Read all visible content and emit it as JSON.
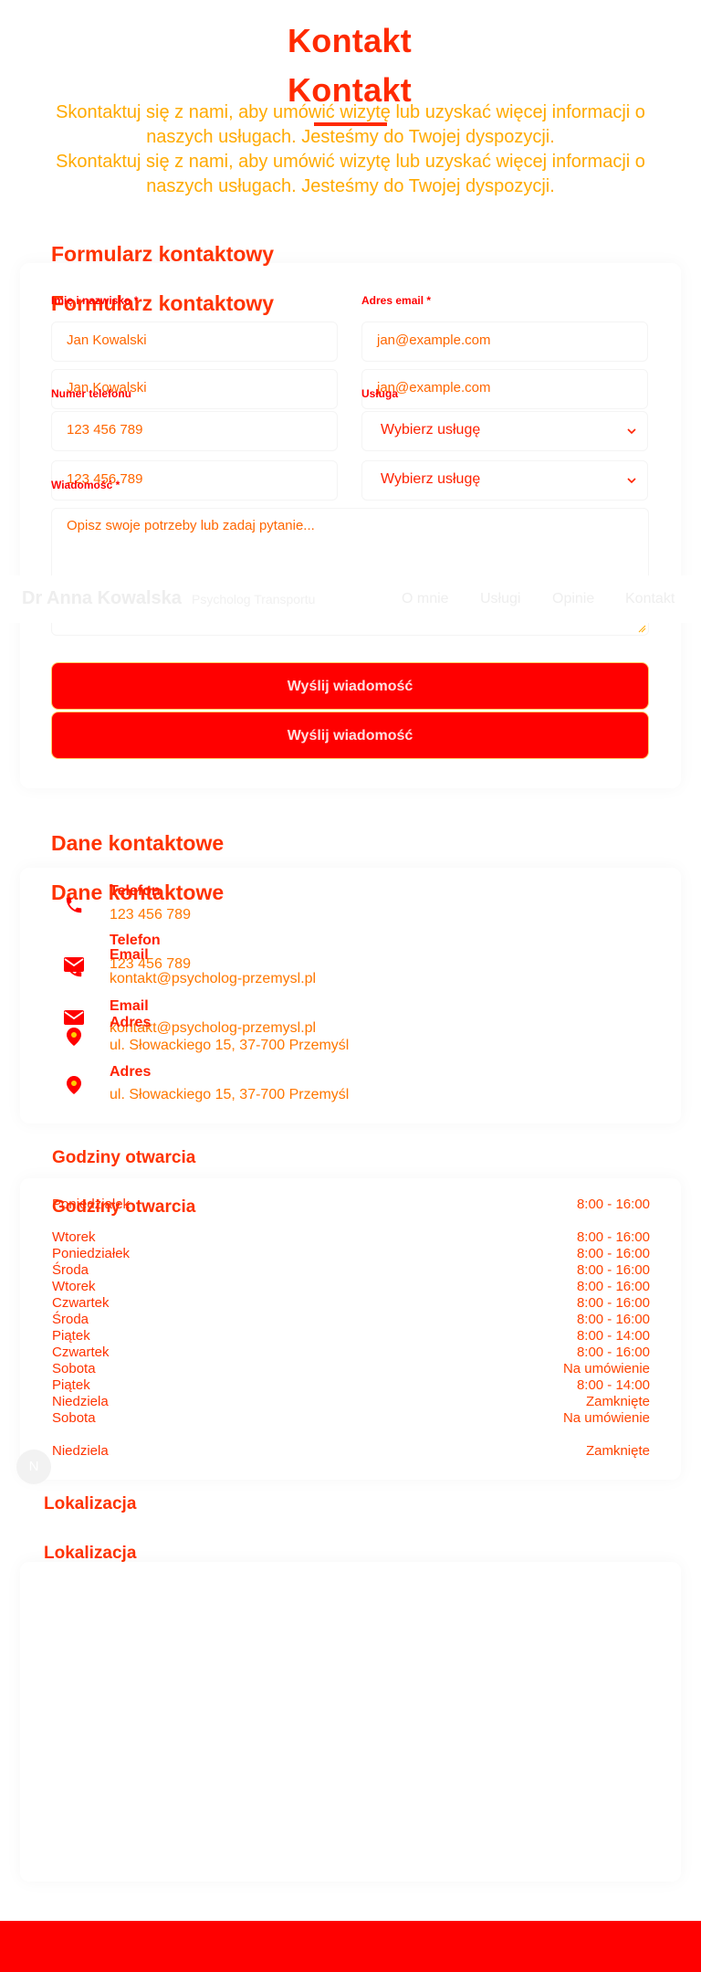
{
  "page": {
    "title": "Kontakt",
    "subtitle": "Skontaktuj się z nami, aby umówić wizytę lub uzyskać więcej informacji o naszych usługach. Jesteśmy do Twojej dyspozycji."
  },
  "navbar": {
    "brand": "Dr Anna Kowalska",
    "tagline": "Psycholog Transportu",
    "links": [
      "O mnie",
      "Usługi",
      "Opinie",
      "Kontakt"
    ]
  },
  "form": {
    "title": "Formularz kontaktowy",
    "name_label": "Imię i nazwisko *",
    "name_placeholder": "Jan Kowalski",
    "email_label": "Adres email *",
    "email_placeholder": "jan@example.com",
    "phone_label": "Numer telefonu",
    "phone_placeholder": "123 456 789",
    "service_label": "Usługa",
    "service_selected": "Wybierz usługę",
    "message_label": "Wiadomość *",
    "message_placeholder": "Opisz swoje potrzeby lub zadaj pytanie...",
    "submit_label": "Wyślij wiadomość"
  },
  "contact": {
    "title": "Dane kontaktowe",
    "items": [
      {
        "icon": "phone-icon",
        "label": "Telefon",
        "value": "123 456 789"
      },
      {
        "icon": "envelope-icon",
        "label": "Email",
        "value": "kontakt@psycholog-przemysl.pl"
      },
      {
        "icon": "map-pin-icon",
        "label": "Adres",
        "value": "ul. Słowackiego 15, 37-700 Przemyśl"
      }
    ]
  },
  "hours": {
    "title": "Godziny otwarcia",
    "rows": [
      {
        "day": "Poniedziałek",
        "time": "8:00 - 16:00"
      },
      {
        "day": "Wtorek",
        "time": "8:00 - 16:00"
      },
      {
        "day": "Środa",
        "time": "8:00 - 16:00"
      },
      {
        "day": "Czwartek",
        "time": "8:00 - 16:00"
      },
      {
        "day": "Piątek",
        "time": "8:00 - 14:00"
      },
      {
        "day": "Sobota",
        "time": "Na umówienie"
      },
      {
        "day": "Niedziela",
        "time": "Zamknięte"
      }
    ]
  },
  "location": {
    "title": "Lokalizacja"
  },
  "floating_badge": "N",
  "colors": {
    "accent": "#ff0000",
    "heading": "#ff2a00",
    "text": "#ffaa00"
  }
}
